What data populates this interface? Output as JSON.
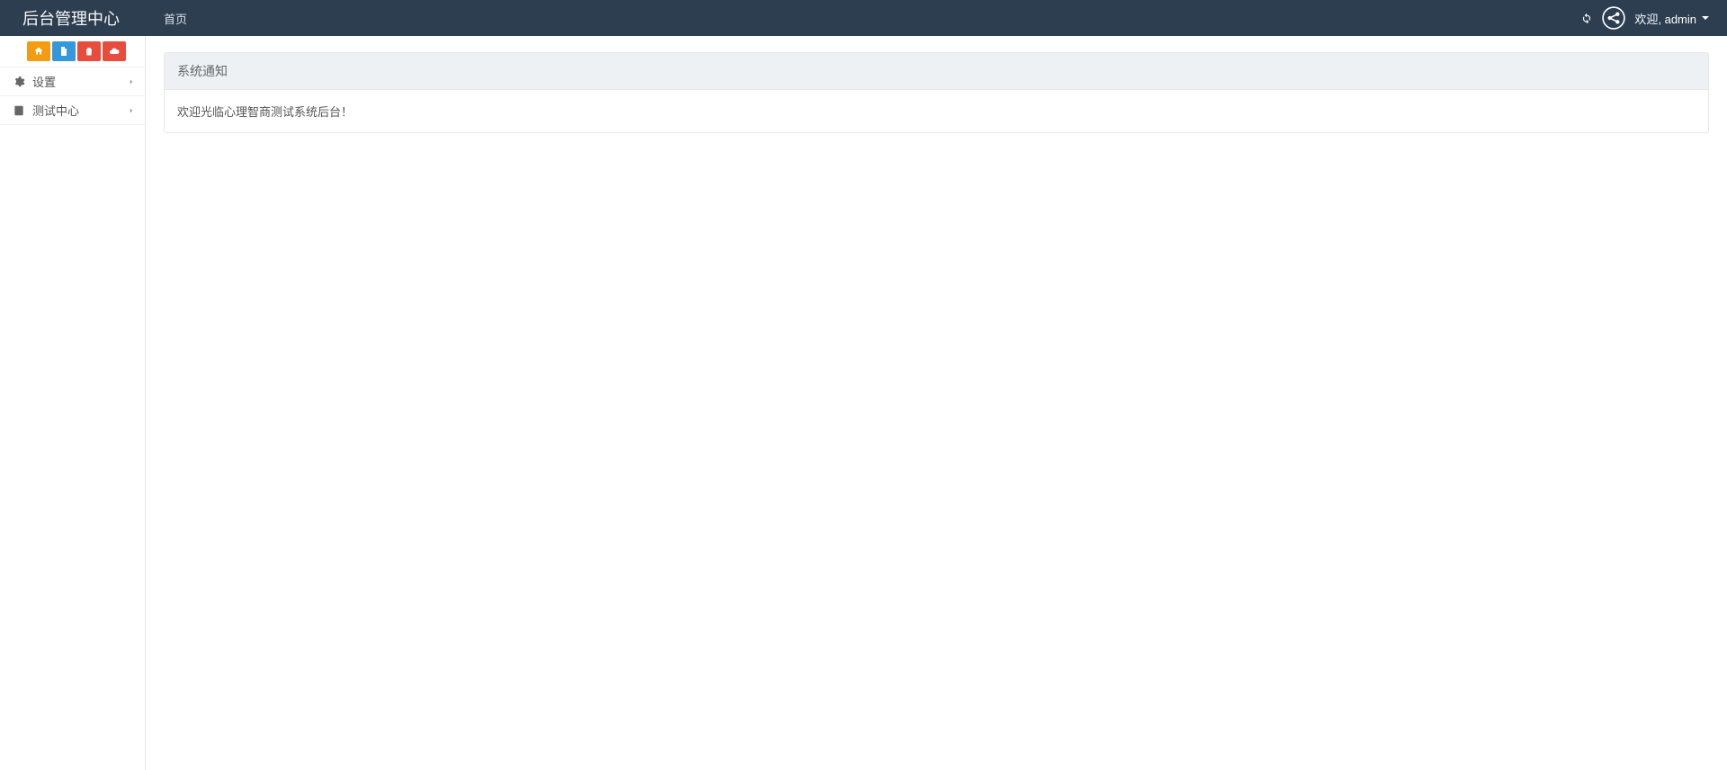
{
  "header": {
    "brand": "后台管理中心",
    "tabs": [
      {
        "label": "首页"
      }
    ],
    "welcome": "欢迎, admin"
  },
  "sidebar": {
    "quick_buttons": [
      {
        "name": "home-icon"
      },
      {
        "name": "file-icon"
      },
      {
        "name": "trash-icon"
      },
      {
        "name": "cloud-icon"
      }
    ],
    "items": [
      {
        "icon": "gears-icon",
        "label": "设置"
      },
      {
        "icon": "book-icon",
        "label": "测试中心"
      }
    ]
  },
  "panel": {
    "title": "系统通知",
    "body": "欢迎光临心理智商测试系统后台！"
  }
}
